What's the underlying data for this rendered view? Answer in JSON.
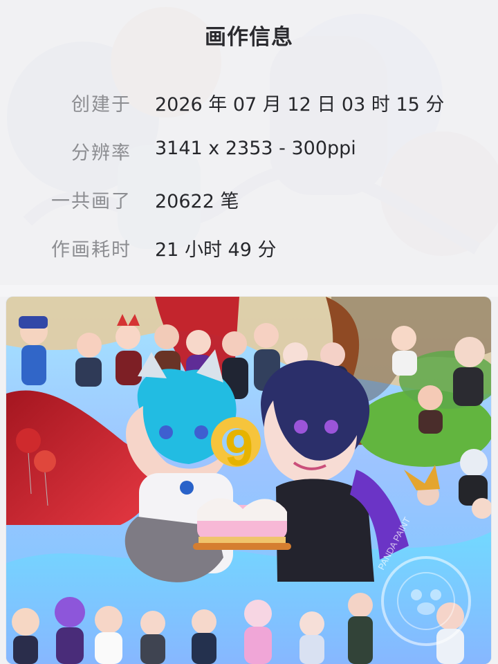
{
  "panel": {
    "title": "画作信息",
    "rows": [
      {
        "label": "创建于",
        "value": "2026 年 07 月 12 日 03 时 15 分"
      },
      {
        "label": "分辨率",
        "value": "3141 x 2353 - 300ppi"
      },
      {
        "label": "一共画了",
        "value": "20622 笔"
      },
      {
        "label": "作画耗时",
        "value": "21 小时 49 分"
      }
    ]
  },
  "artwork": {
    "cake_number": "9",
    "watermark_text": "PANDA PAINT"
  },
  "colors": {
    "background": "#f2f2f4",
    "title": "#2b2b2f",
    "label": "#8c8d91",
    "value": "#26272b"
  },
  "icons": {
    "watermark": "panda-watermark-icon"
  }
}
